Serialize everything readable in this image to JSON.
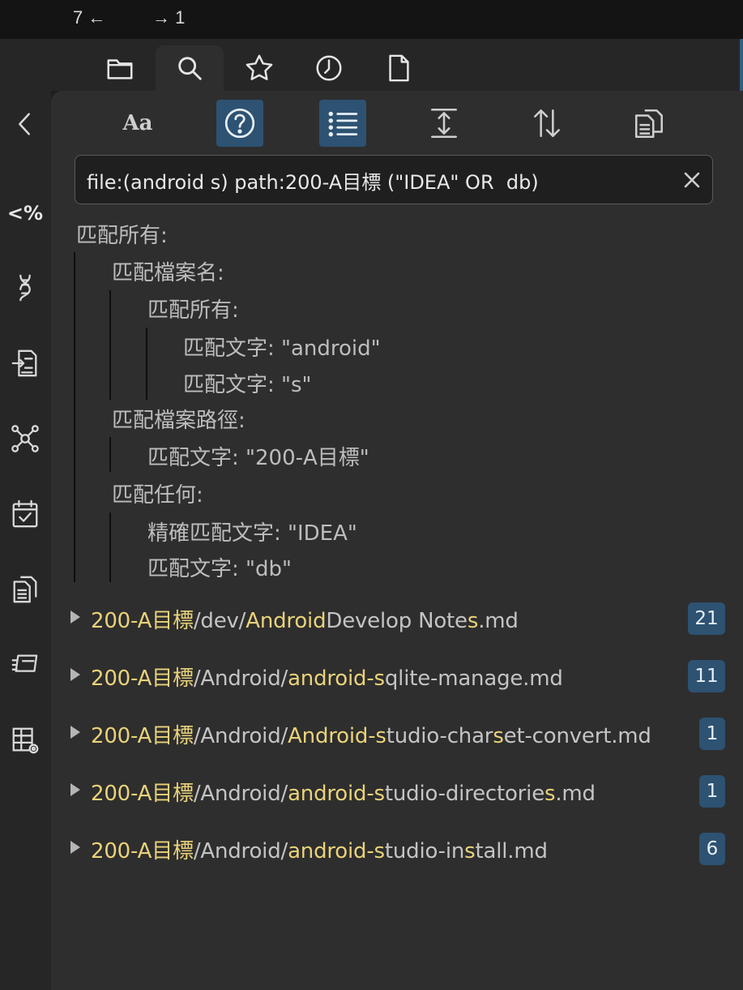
{
  "nav": {
    "back": "7 ←",
    "forward": "→ 1"
  },
  "tabs": [
    {
      "name": "files",
      "icon": "folder-icon"
    },
    {
      "name": "search",
      "icon": "search-icon",
      "active": true
    },
    {
      "name": "bookmarks",
      "icon": "star-icon"
    },
    {
      "name": "recent",
      "icon": "clock-icon"
    },
    {
      "name": "file",
      "icon": "file-icon"
    }
  ],
  "rail": {
    "template_label": "<%",
    "icons": [
      "chevron-left-icon",
      "template-icon",
      "dna-icon",
      "import-icon",
      "graph-icon",
      "calendar-icon",
      "copy-icon",
      "slides-icon",
      "table-settings-icon"
    ]
  },
  "toolbar": {
    "match_case_label": "Aa",
    "items": [
      "match-case",
      "explain-search",
      "collapse-results",
      "show-more-context",
      "sort-order",
      "copy-results"
    ],
    "active": [
      "explain-search",
      "collapse-results"
    ]
  },
  "search": {
    "value": "file:(android s) path:200-A目標 (\"IDEA\" OR  db)"
  },
  "explain": {
    "l0": "匹配所有:",
    "l1": "匹配檔案名:",
    "l2": "匹配所有:",
    "l3": "匹配文字: \"android\"",
    "l4": "匹配文字: \"s\"",
    "l5": "匹配檔案路徑:",
    "l6": "匹配文字: \"200-A目標\"",
    "l7": "匹配任何:",
    "l8": "精確匹配文字: \"IDEA\"",
    "l9": "匹配文字: \"db\""
  },
  "results": [
    {
      "segments": [
        {
          "t": "200-A目標",
          "h": true
        },
        {
          "t": "/dev/",
          "h": false
        },
        {
          "t": "Android",
          "h": true
        },
        {
          "t": "Develop Note",
          "h": false
        },
        {
          "t": "s",
          "h": true
        },
        {
          "t": ".md",
          "h": false
        }
      ],
      "count": "21"
    },
    {
      "segments": [
        {
          "t": "200-A目標",
          "h": true
        },
        {
          "t": "/Android/",
          "h": false
        },
        {
          "t": "android-s",
          "h": true
        },
        {
          "t": "qlite-manage.md",
          "h": false
        }
      ],
      "count": "11"
    },
    {
      "segments": [
        {
          "t": "200-A目標",
          "h": true
        },
        {
          "t": "/Android/",
          "h": false
        },
        {
          "t": "Android-s",
          "h": true
        },
        {
          "t": "tudio-char",
          "h": false
        },
        {
          "t": "s",
          "h": true
        },
        {
          "t": "et-convert.md",
          "h": false
        }
      ],
      "count": "1"
    },
    {
      "segments": [
        {
          "t": "200-A目標",
          "h": true
        },
        {
          "t": "/Android/",
          "h": false
        },
        {
          "t": "android-s",
          "h": true
        },
        {
          "t": "tudio-directorie",
          "h": false
        },
        {
          "t": "s",
          "h": true
        },
        {
          "t": ".md",
          "h": false
        }
      ],
      "count": "1"
    },
    {
      "segments": [
        {
          "t": "200-A目標",
          "h": true
        },
        {
          "t": "/Android/",
          "h": false
        },
        {
          "t": "android-s",
          "h": true
        },
        {
          "t": "tudio-in",
          "h": false
        },
        {
          "t": "s",
          "h": true
        },
        {
          "t": "tall.md",
          "h": false
        }
      ],
      "count": "6"
    }
  ],
  "colors": {
    "accent": "#2d5272",
    "highlight": "#e9d27a",
    "panel": "#2e2e2e"
  }
}
